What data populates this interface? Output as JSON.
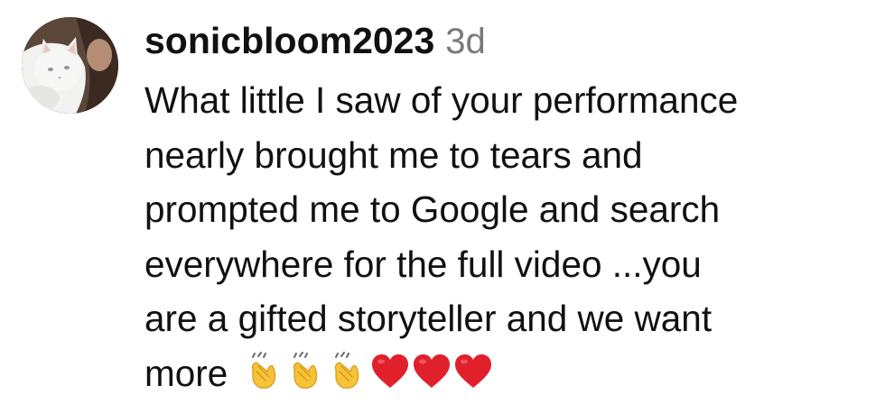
{
  "comment": {
    "username": "sonicbloom2023",
    "timestamp": "3d",
    "lines": [
      "What little I saw of your performance",
      "nearly brought me to tears and",
      "prompted me to Google and search",
      "everywhere for the full video ...you",
      "are a gifted storyteller and we want",
      "more"
    ],
    "emojis": [
      "clapping-hands",
      "clapping-hands",
      "clapping-hands",
      "red-heart",
      "red-heart",
      "red-heart"
    ]
  },
  "colors": {
    "username": "#111111",
    "timestamp": "#7a7a7a",
    "text": "#111111",
    "heart": "#e0202b",
    "clap": "#f6c338"
  }
}
